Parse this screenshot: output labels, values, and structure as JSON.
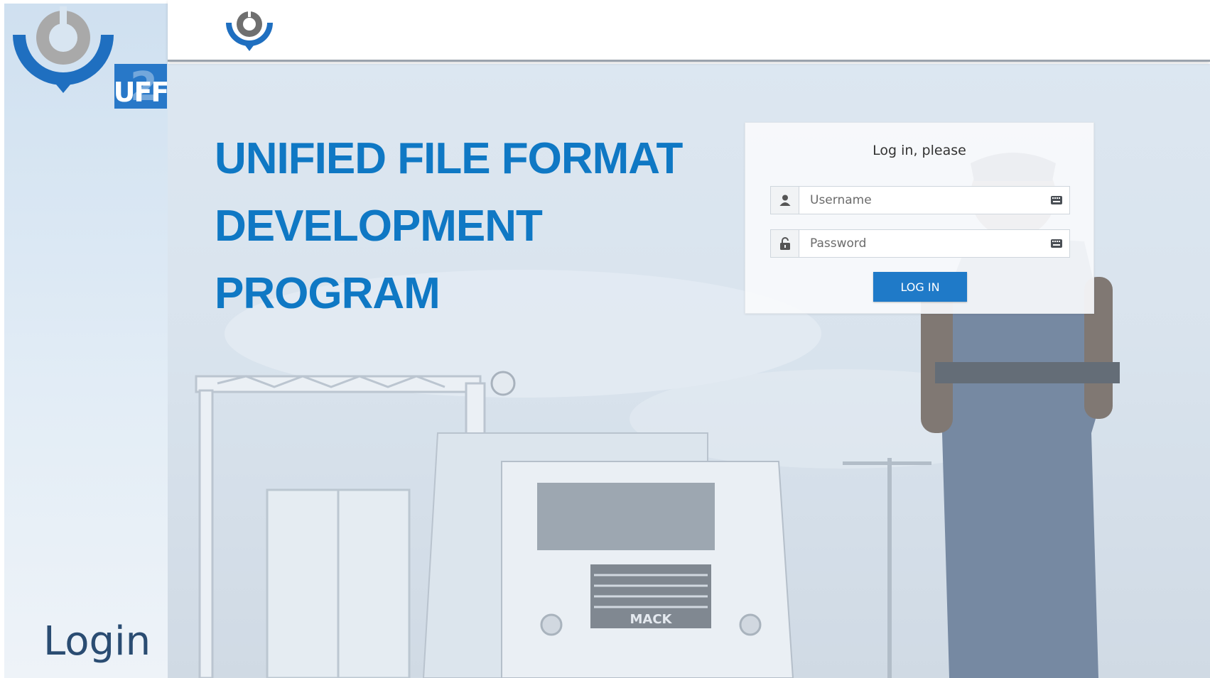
{
  "brand": {
    "badge_text": "UFF",
    "badge_overlay": "2",
    "primary_color": "#1f6fc0",
    "logo_grey": "#a9a9a9"
  },
  "sidebar": {
    "caption": "Login"
  },
  "hero": {
    "line1": "UNIFIED FILE FORMAT",
    "line2": "DEVELOPMENT",
    "line3": "PROGRAM",
    "color": "#0f78c4"
  },
  "login_form": {
    "title": "Log in, please",
    "username_placeholder": "Username",
    "password_placeholder": "Password",
    "submit_label": "LOG IN",
    "username_icon": "user-icon",
    "password_icon": "unlock-icon",
    "field_trailing_icon": "keyboard-icon"
  },
  "background": {
    "truck_brand": "MACK"
  }
}
